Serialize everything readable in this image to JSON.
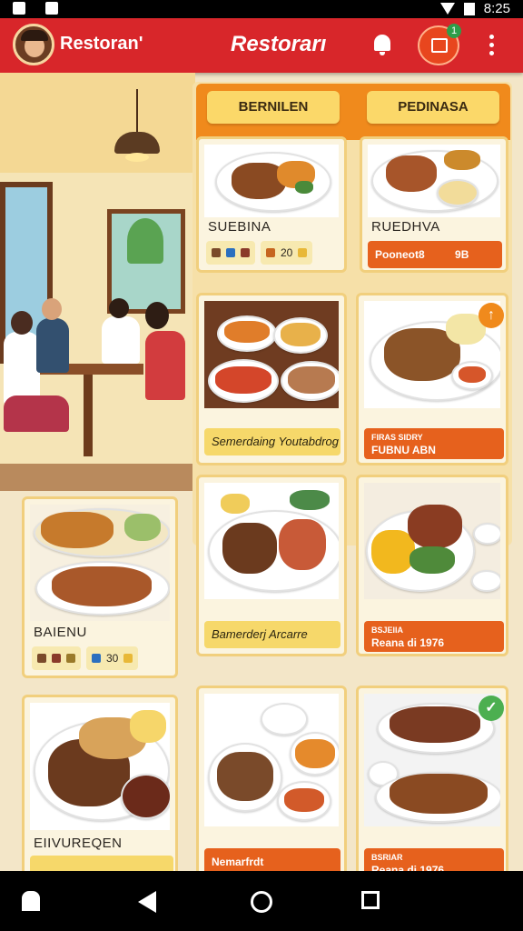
{
  "status_bar": {
    "time": "8:25"
  },
  "app_bar": {
    "left_title": "Restoran'",
    "center_title": "Restorarı",
    "notification_count": "1"
  },
  "tabs": [
    "BERNILEN",
    "PEDINASA"
  ],
  "cards": [
    {
      "title": "SUEBINA",
      "pills": [
        "",
        "",
        "20"
      ]
    },
    {
      "title": "RUEDHVA",
      "strip": "Pooneot8",
      "strip_extra": "9B"
    },
    {
      "strip": "Semerdaing Youtabdrog"
    },
    {
      "strip_top": "FIRAS SIDRY",
      "strip": "FUBNU ABN"
    },
    {
      "title": "BAIENU",
      "pills": [
        "",
        "",
        "30"
      ]
    },
    {
      "strip": "Bamerderj Arcarre"
    },
    {
      "strip_top": "BSJEIIA",
      "strip": "Reana di 1976"
    },
    {
      "title": "EIIVUREQEN"
    },
    {
      "strip": "Nemarfrdt"
    },
    {
      "strip_top": "BSRIAR",
      "strip": "Reana di 1976"
    }
  ],
  "colors": {
    "app_bar": "#d8262a",
    "tab_header": "#f08a1c",
    "tab_button": "#fbd869",
    "strip_orange": "#e6611d",
    "strip_yellow": "#f6d86a"
  },
  "icons": [
    "avatar",
    "bell-icon",
    "chart-icon",
    "more-vert-icon",
    "arrow-up-icon",
    "check-icon",
    "back-icon",
    "home-icon",
    "recents-icon"
  ]
}
